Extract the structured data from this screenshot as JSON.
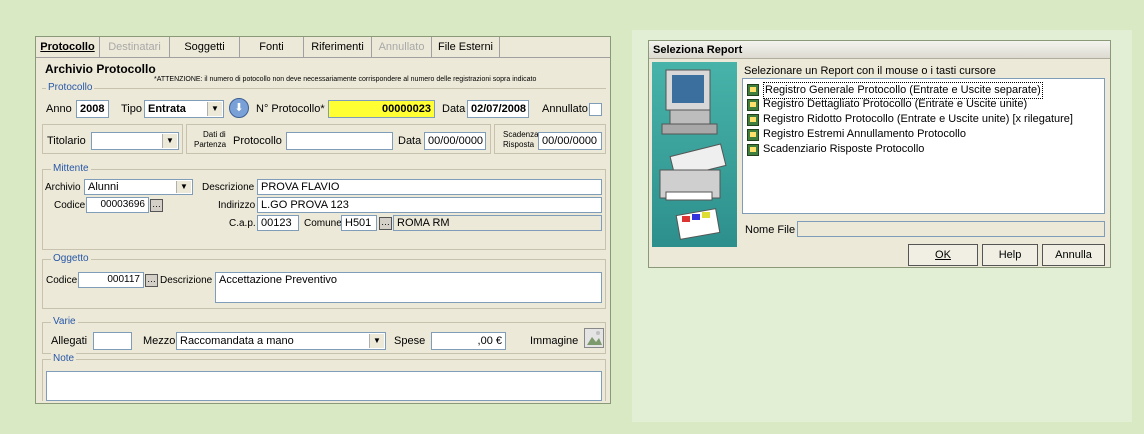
{
  "colors": {
    "background": "#d9e9c4",
    "window": "#ece9d8",
    "highlight": "#ffff33",
    "group_title": "#2857a8"
  },
  "left": {
    "tabs": [
      {
        "label": "Protocollo",
        "state": "active"
      },
      {
        "label": "Destinatari",
        "state": "disabled"
      },
      {
        "label": "Soggetti",
        "state": "normal"
      },
      {
        "label": "Fonti",
        "state": "normal"
      },
      {
        "label": "Riferimenti",
        "state": "normal"
      },
      {
        "label": "Annullato",
        "state": "disabled"
      },
      {
        "label": "File Esterni",
        "state": "normal"
      }
    ],
    "title": "Archivio Protocollo",
    "warning": "*ATTENZIONE: il numero di potocollo non deve necessariamente corrispondere al numero delle registrazioni sopra indicato",
    "protocollo": {
      "group_label": "Protocollo",
      "anno_label": "Anno",
      "anno_value": "2008",
      "tipo_label": "Tipo",
      "tipo_value": "Entrata",
      "numero_label": "N° Protocollo*",
      "numero_value": "00000023",
      "data_label": "Data",
      "data_value": "02/07/2008",
      "annullato_label": "Annullato"
    },
    "titolario": {
      "label": "Titolario",
      "value": "",
      "dati_partenza_label_1": "Dati di",
      "dati_partenza_label_2": "Partenza",
      "protocollo_label": "Protocollo",
      "protocollo_value": "",
      "data_label": "Data",
      "data_value": "00/00/0000",
      "scadenza_label_1": "Scadenza",
      "scadenza_label_2": "Risposta",
      "scadenza_value": "00/00/0000"
    },
    "mittente": {
      "group_label": "Mittente",
      "archivio_label": "Archivio",
      "archivio_value": "Alunni",
      "codice_label": "Codice",
      "codice_value": "00003696",
      "descrizione_label": "Descrizione",
      "descrizione_value": "PROVA  FLAVIO",
      "indirizzo_label": "Indirizzo",
      "indirizzo_value": "L.GO PROVA 123",
      "cap_label": "C.a.p.",
      "cap_value": "00123",
      "comune_label": "Comune",
      "comune_code": "H501",
      "comune_name": "ROMA  RM"
    },
    "oggetto": {
      "group_label": "Oggetto",
      "codice_label": "Codice",
      "codice_value": "000117",
      "descrizione_label": "Descrizione",
      "descrizione_value": "Accettazione Preventivo"
    },
    "varie": {
      "group_label": "Varie",
      "allegati_label": "Allegati",
      "allegati_value": "",
      "mezzo_label": "Mezzo",
      "mezzo_value": "Raccomandata a mano",
      "spese_label": "Spese",
      "spese_value": ",00 €",
      "immagine_label": "Immagine"
    },
    "note": {
      "group_label": "Note",
      "value": ""
    }
  },
  "report": {
    "title": "Seleziona Report",
    "instruction": "Selezionare un Report con il mouse o i tasti cursore",
    "items": [
      {
        "label": "Registro Generale Protocollo (Entrate e Uscite separate)",
        "selected": true
      },
      {
        "label": "Registro Dettagliato Protocollo (Entrate e Uscite unite)",
        "selected": false
      },
      {
        "label": "Registro Ridotto Protocollo (Entrate e Uscite unite) [x rilegature]",
        "selected": false
      },
      {
        "label": "Registro Estremi Annullamento Protocollo",
        "selected": false
      },
      {
        "label": "Scadenziario Risposte Protocollo",
        "selected": false
      }
    ],
    "nome_file_label": "Nome File",
    "nome_file_value": "",
    "ok_label": "OK",
    "help_label": "Help",
    "annulla_label": "Annulla"
  }
}
